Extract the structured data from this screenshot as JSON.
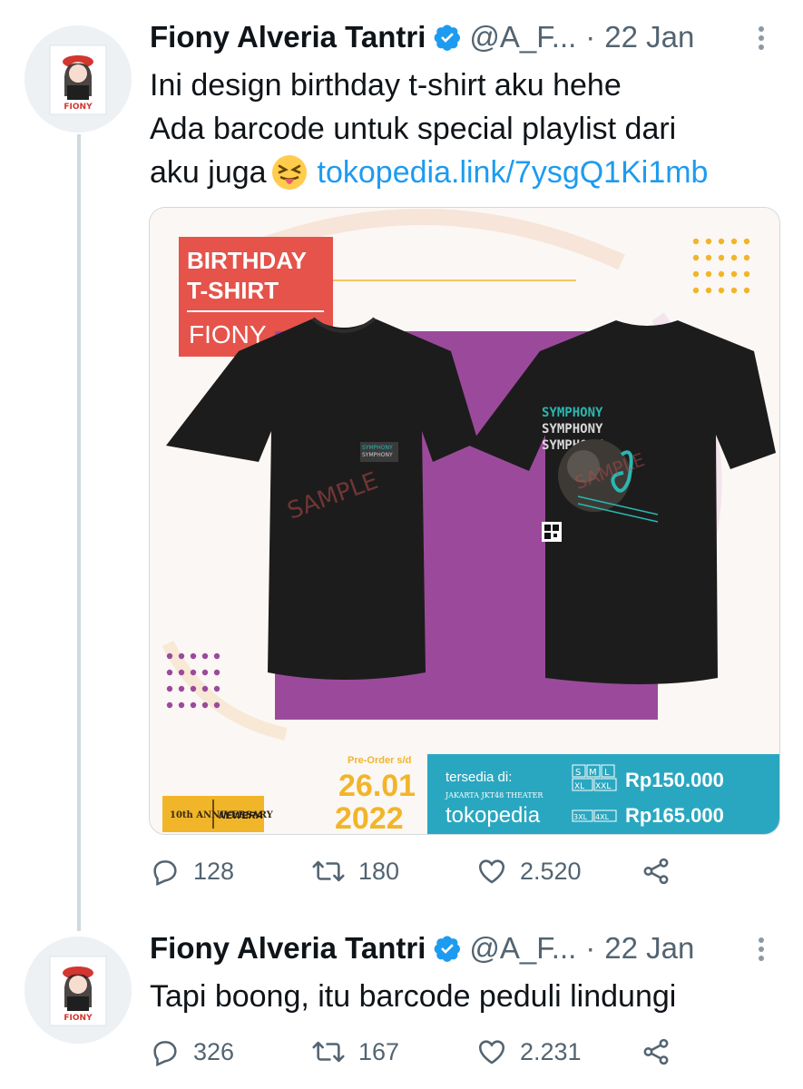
{
  "tweets": [
    {
      "author_name": "Fiony Alveria Tantri",
      "handle": "@A_F...",
      "separator": "·",
      "date": "22 Jan",
      "text_line1": "Ini design birthday t-shirt aku hehe",
      "text_line2": "Ada barcode untuk special playlist dari",
      "text_line3": "aku juga",
      "link": "tokopedia.link/7ysgQ1Ki1mb",
      "replies": "128",
      "retweets": "180",
      "likes": "2.520"
    },
    {
      "author_name": "Fiony Alveria Tantri",
      "handle": "@A_F...",
      "separator": "·",
      "date": "22 Jan",
      "text_line1": "Tapi boong, itu barcode peduli lindungi",
      "replies": "326",
      "retweets": "167",
      "likes": "2.231"
    }
  ],
  "avatar_label": "FIONY",
  "promo": {
    "title_line1": "BIRTHDAY",
    "title_line2": "T-SHIRT",
    "subtitle": "FIONY",
    "watermark": "SAMPLE",
    "print_word": "SYMPHONY",
    "preorder_label": "Pre-Order s/d",
    "preorder_date1": "26.01",
    "preorder_date2": "2022",
    "available_label": "tersedia di:",
    "theater": "JAKARTA JKT48 THEATER",
    "store": "tokopedia",
    "size_row1": [
      "S",
      "M",
      "L"
    ],
    "size_row1b": [
      "XL",
      "XXL"
    ],
    "price1": "Rp150.000",
    "size_row2": [
      "3XL",
      "4XL"
    ],
    "price2": "Rp165.000",
    "logo1": "10th ANNIVERSARY",
    "logo2": "NEWERA"
  },
  "colors": {
    "accent_link": "#1d9bf0",
    "verified": "#1d9bf0",
    "promo_red": "#e5534b",
    "promo_purple": "#9b4a9b",
    "promo_teal": "#2aa7c0",
    "promo_yellow": "#f1b52a"
  }
}
